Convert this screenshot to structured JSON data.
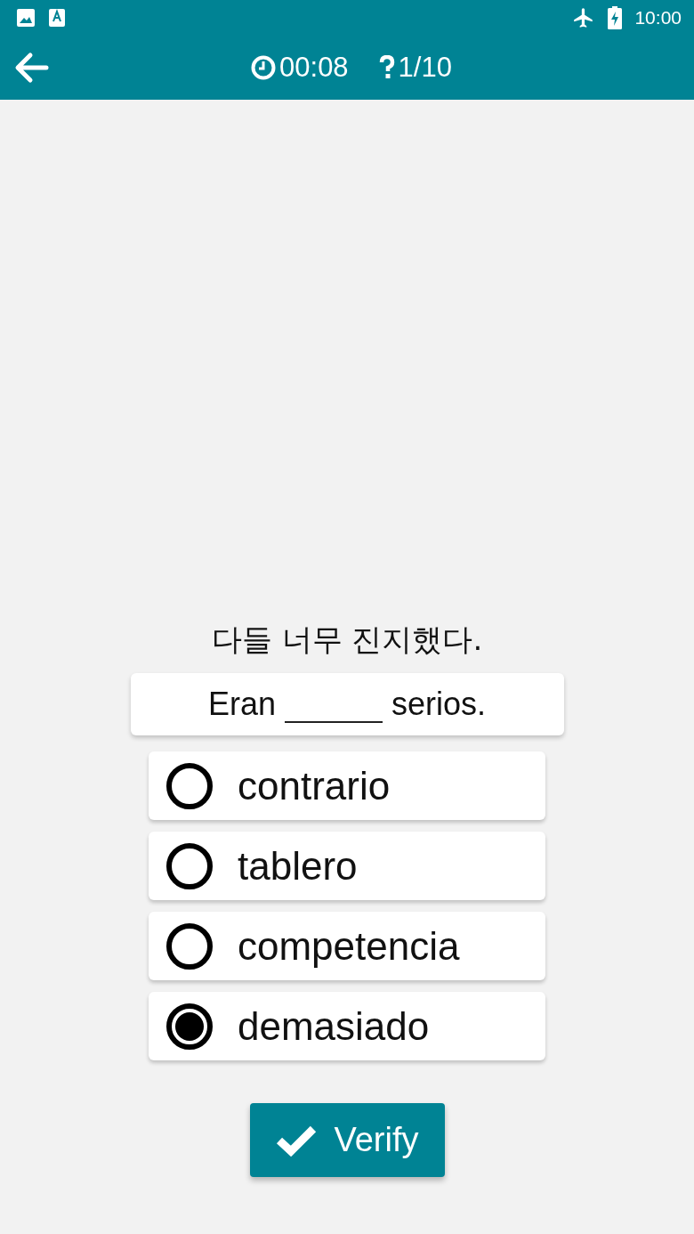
{
  "status_bar": {
    "time": "10:00"
  },
  "toolbar": {
    "timer": "00:08",
    "progress": "1/10"
  },
  "question": {
    "prompt": "다들 너무 진지했다.",
    "sentence_start": "Eran",
    "sentence_end": "serios."
  },
  "options": [
    {
      "label": "contrario",
      "selected": false
    },
    {
      "label": "tablero",
      "selected": false
    },
    {
      "label": "competencia",
      "selected": false
    },
    {
      "label": "demasiado",
      "selected": true
    }
  ],
  "verify_button": {
    "label": "Verify"
  }
}
